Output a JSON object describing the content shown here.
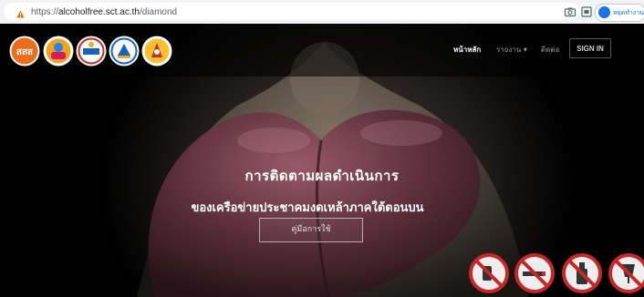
{
  "browser": {
    "url_scheme": "https://",
    "url_domain": "alcoholfree.sct.ac.th",
    "url_path": "/diamond",
    "profile_label": "หยุดทำงาน"
  },
  "navbar": {
    "logos": [
      "สสส",
      "logo-2",
      "logo-3",
      "logo-4",
      "logo-5"
    ],
    "items": [
      {
        "label": "หน้าหลัก",
        "active": true
      },
      {
        "label": "รายงาน ▾",
        "active": false
      },
      {
        "label": "ติดต่อ",
        "active": false
      }
    ],
    "signin_label": "SIGN IN"
  },
  "hero": {
    "title": "การติดตามผลดำเนินการ",
    "subtitle": "ของเครือข่ายประชาคมงดเหล้าภาคใต้ตอนบน",
    "guide_button": "คู่มือการใช้"
  },
  "colors": {
    "accent_red": "#c62828",
    "nav_bg": "#0d0d0d"
  },
  "icons": [
    "no-drinking-sign-icon",
    "no-smoking-sign-icon",
    "no-bottle-sign-icon",
    "no-alcohol-sign-icon"
  ]
}
